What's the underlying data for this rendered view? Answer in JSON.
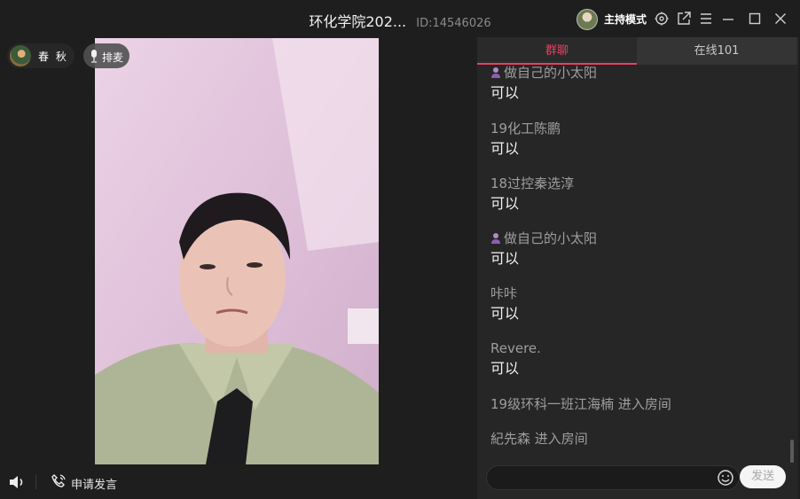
{
  "window": {
    "title": "环化学院202...",
    "room_id": "ID:14546026",
    "host_mode_label": "主持模式"
  },
  "stage": {
    "user_name": "春 秋",
    "mic_label": "排麦"
  },
  "bottom": {
    "apply_speak_label": "申请发言"
  },
  "panel": {
    "tabs": [
      {
        "label": "群聊",
        "active": true
      },
      {
        "label": "在线101",
        "active": false
      }
    ],
    "messages": [
      {
        "name": "做自己的小太阳",
        "text": "可以",
        "badge": true
      },
      {
        "name": "19化工陈鹏",
        "text": "可以",
        "badge": false
      },
      {
        "name": "18过控秦选淳",
        "text": "可以",
        "badge": false
      },
      {
        "name": "做自己的小太阳",
        "text": "可以",
        "badge": true
      },
      {
        "name": "咔咔",
        "text": "可以",
        "badge": false
      },
      {
        "name": "Revere.",
        "text": "可以",
        "badge": false
      }
    ],
    "system_messages": [
      "19级环科一班江海楠 进入房间",
      "紀先森 进入房间"
    ],
    "input_placeholder": "",
    "send_label": "发送"
  },
  "colors": {
    "accent": "#e9405f",
    "background": "#1e1e1e",
    "panel": "#262626"
  },
  "icons": [
    "host-avatar",
    "settings-icon",
    "popout-icon",
    "menu-icon",
    "minimize-icon",
    "maximize-icon",
    "close-icon",
    "microphone-icon",
    "speaker-icon",
    "phone-icon",
    "emoji-icon",
    "vip-badge-icon"
  ]
}
